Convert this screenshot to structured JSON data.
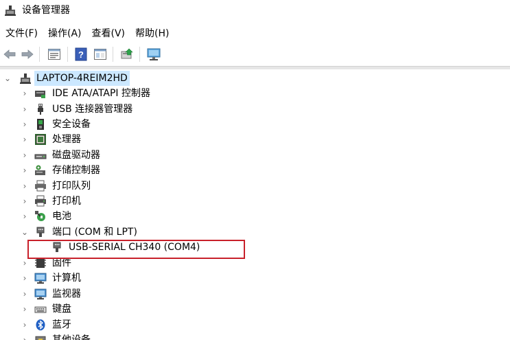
{
  "window": {
    "title": "设备管理器"
  },
  "menu": [
    {
      "label": "文件(F)"
    },
    {
      "label": "操作(A)"
    },
    {
      "label": "查看(V)"
    },
    {
      "label": "帮助(H)"
    }
  ],
  "toolbar": {
    "buttons": [
      {
        "name": "back-button",
        "icon": "arrow-left-icon"
      },
      {
        "name": "forward-button",
        "icon": "arrow-right-icon"
      },
      {
        "name": "properties-button",
        "icon": "properties-icon"
      },
      {
        "name": "help-button",
        "icon": "help-icon"
      },
      {
        "name": "show-hidden-button",
        "icon": "window-icon"
      },
      {
        "name": "update-driver-button",
        "icon": "update-driver-icon"
      },
      {
        "name": "scan-hardware-button",
        "icon": "monitor-icon"
      }
    ]
  },
  "tree": {
    "root": "LAPTOP-4REIM2HD",
    "categories": [
      {
        "label": "IDE ATA/ATAPI 控制器",
        "icon": "ide-controller-icon",
        "expanded": false
      },
      {
        "label": "USB 连接器管理器",
        "icon": "usb-connector-icon",
        "expanded": false
      },
      {
        "label": "安全设备",
        "icon": "security-device-icon",
        "expanded": false
      },
      {
        "label": "处理器",
        "icon": "processor-icon",
        "expanded": false
      },
      {
        "label": "磁盘驱动器",
        "icon": "disk-drive-icon",
        "expanded": false
      },
      {
        "label": "存储控制器",
        "icon": "storage-controller-icon",
        "expanded": false
      },
      {
        "label": "打印队列",
        "icon": "print-queue-icon",
        "expanded": false
      },
      {
        "label": "打印机",
        "icon": "printer-icon",
        "expanded": false
      },
      {
        "label": "电池",
        "icon": "battery-icon",
        "expanded": false
      },
      {
        "label": "端口 (COM 和 LPT)",
        "icon": "port-icon",
        "expanded": true,
        "children": [
          {
            "label": "USB-SERIAL CH340 (COM4)",
            "icon": "port-icon"
          }
        ]
      },
      {
        "label": "固件",
        "icon": "firmware-icon",
        "expanded": false
      },
      {
        "label": "计算机",
        "icon": "computer-icon",
        "expanded": false
      },
      {
        "label": "监视器",
        "icon": "monitor-icon",
        "expanded": false
      },
      {
        "label": "键盘",
        "icon": "keyboard-icon",
        "expanded": false
      },
      {
        "label": "蓝牙",
        "icon": "bluetooth-icon",
        "expanded": false
      },
      {
        "label": "其他设备",
        "icon": "other-device-icon",
        "expanded": false
      }
    ]
  },
  "annotation": {
    "color": "#c8202a"
  }
}
